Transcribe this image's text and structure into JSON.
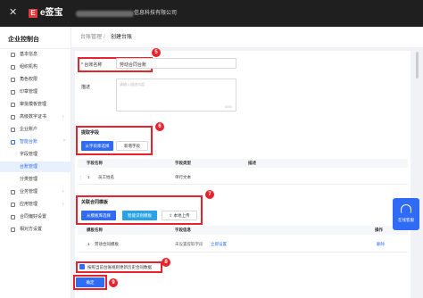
{
  "topbar": {
    "close_glyph": "✕",
    "logo_glyph": "E",
    "brand": "e签宝",
    "company": "信息科技有限公司"
  },
  "sidebar": {
    "title": "企业控制台",
    "items": [
      {
        "label": "基本信息",
        "arrow": ""
      },
      {
        "label": "组织机构",
        "arrow": ""
      },
      {
        "label": "角色权限",
        "arrow": ""
      },
      {
        "label": "印章管理",
        "arrow": ""
      },
      {
        "label": "审批模板管理",
        "arrow": ""
      },
      {
        "label": "高级数字证书",
        "arrow": "›"
      },
      {
        "label": "企业账户",
        "arrow": ""
      },
      {
        "label": "智能台账",
        "arrow": "⌃"
      }
    ],
    "sub_items": [
      "字段管理",
      "台账管理",
      "分类管理"
    ],
    "items_after": [
      {
        "label": "业务管理",
        "arrow": "›"
      },
      {
        "label": "应用管理",
        "arrow": "›"
      },
      {
        "label": "合同偏好设置",
        "arrow": ""
      },
      {
        "label": "相对方设置",
        "arrow": ""
      }
    ]
  },
  "breadcrumb": {
    "parent": "台账管理",
    "separator": "/",
    "current": "创建台账"
  },
  "form": {
    "name_label": "* 台账名称",
    "name_value": "劳动合同台账",
    "desc_label": "描述",
    "desc_placeholder": "请输入描述内容",
    "desc_counter": "0/50"
  },
  "fields_section": {
    "title": "提取字段",
    "btn_select": "从字段库选择",
    "btn_add": "新增字段",
    "headers": [
      "字段名称",
      "字段类型",
      "描述"
    ],
    "rows": [
      {
        "handle": "⋮",
        "index": "1",
        "name": "员工姓名",
        "type": "单行文本",
        "desc": ""
      }
    ]
  },
  "template_section": {
    "title": "关联合同模板",
    "btn_select": "从模板库选择",
    "btn_ai": "智能识别模板",
    "btn_upload": "本地上传",
    "upload_icon": "⇪",
    "headers": [
      "模板名称",
      "字段信息",
      "操作"
    ],
    "rows": [
      {
        "index": "1",
        "name": "劳动合同模板",
        "status": "未设置提取字段",
        "link": "立即设置",
        "action": "删除"
      }
    ]
  },
  "checkbox": {
    "label": "按照当前台账规则更新历史合同数据",
    "checked": true
  },
  "submit_label": "确定",
  "badges": [
    "5",
    "6",
    "7",
    "8",
    "9"
  ],
  "float_button": {
    "label": "在线客服"
  },
  "colors": {
    "topbar": "#1f1f1f",
    "primary": "#2f6bf5",
    "highlight": "#e8232d",
    "brand_logo": "#e4393c"
  }
}
